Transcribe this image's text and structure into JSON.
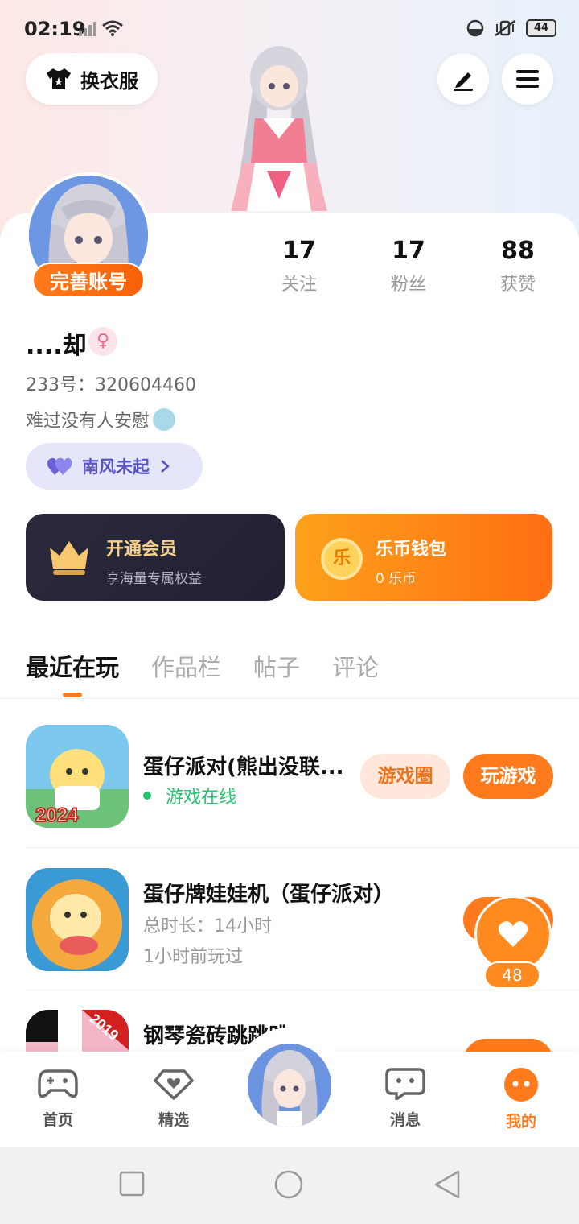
{
  "status_bar": {
    "time": "02:19",
    "battery": "44"
  },
  "header": {
    "dress_button_label": "换衣服"
  },
  "profile": {
    "complete_account_label": "完善账号",
    "stats": [
      {
        "value": "17",
        "label": "关注"
      },
      {
        "value": "17",
        "label": "粉丝"
      },
      {
        "value": "88",
        "label": "获赞"
      }
    ],
    "username": "....却",
    "gender_symbol": "♀",
    "uid": "233号：320604460",
    "bio": "难过没有人安慰",
    "guild_name": "南风未起"
  },
  "cards": {
    "vip": {
      "title": "开通会员",
      "subtitle": "享海量专属权益"
    },
    "wallet": {
      "title": "乐币钱包",
      "subtitle": "0 乐币",
      "coin_char": "乐"
    }
  },
  "tabs": [
    "最近在玩",
    "作品栏",
    "帖子",
    "评论"
  ],
  "games": [
    {
      "name": "蛋仔派对(熊出没联...",
      "status": "游戏在线",
      "circle_label": "游戏圈",
      "play_label": "玩游戏",
      "badge": "2024"
    },
    {
      "name": "蛋仔牌娃娃机（蛋仔派对）",
      "duration": "总时长：14小时",
      "last_played": "1小时前玩过"
    },
    {
      "name": "钢琴瓷砖跳跳跳",
      "badge": "2019"
    }
  ],
  "floating_like": {
    "count": "48"
  },
  "bottom_nav": [
    {
      "label": "首页",
      "icon": "gamepad-icon"
    },
    {
      "label": "精选",
      "icon": "heart-diamond-icon"
    },
    {
      "label": "消息",
      "icon": "chat-icon"
    },
    {
      "label": "我的",
      "icon": "face-icon"
    }
  ],
  "colors": {
    "accent": "#ff7a1c",
    "online": "#24c66d",
    "vip_gold": "#f5d28b"
  }
}
